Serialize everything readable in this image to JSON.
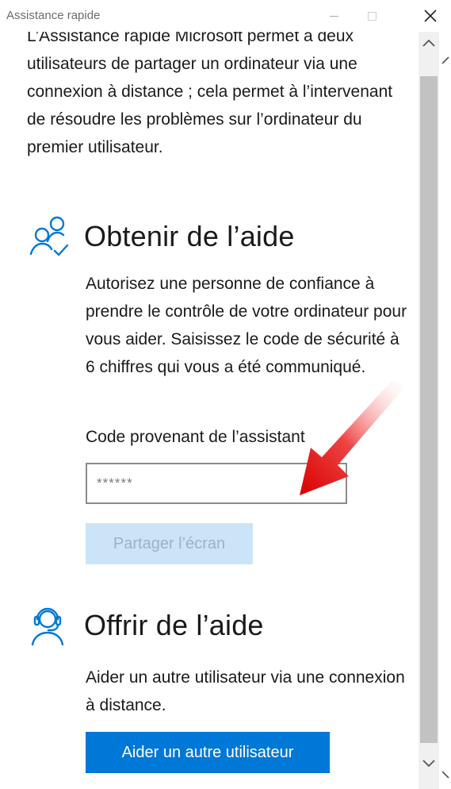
{
  "window": {
    "title": "Assistance rapide",
    "close_glyph": "✕"
  },
  "intro": {
    "text": "L’Assistance rapide Microsoft permet à deux utilisateurs de partager un ordinateur via une connexion à distance ; cela permet à l’intervenant de résoudre les problèmes sur l’ordinateur du premier utilisateur."
  },
  "get_help": {
    "icon": "users-check-icon",
    "title": "Obtenir de l’aide",
    "description": "Autorisez une personne de confiance à prendre le contrôle de votre ordinateur pour vous aider. Saisissez le code de sécurité à 6 chiffres qui vous a été communiqué.",
    "field_label": "Code provenant de l’assistant",
    "code_placeholder": "******",
    "code_value": "",
    "share_button": "Partager l’écran",
    "share_enabled": false
  },
  "give_help": {
    "icon": "headset-user-icon",
    "title": "Offrir de l’aide",
    "description": "Aider un autre utilisateur via une connexion à distance.",
    "help_button": "Aider un autre utilisateur"
  },
  "colors": {
    "accent": "#0078d7",
    "disabled_button_bg": "#cce4f7",
    "disabled_button_text": "#9cb3c7",
    "annotation_arrow": "#e81c1c"
  }
}
